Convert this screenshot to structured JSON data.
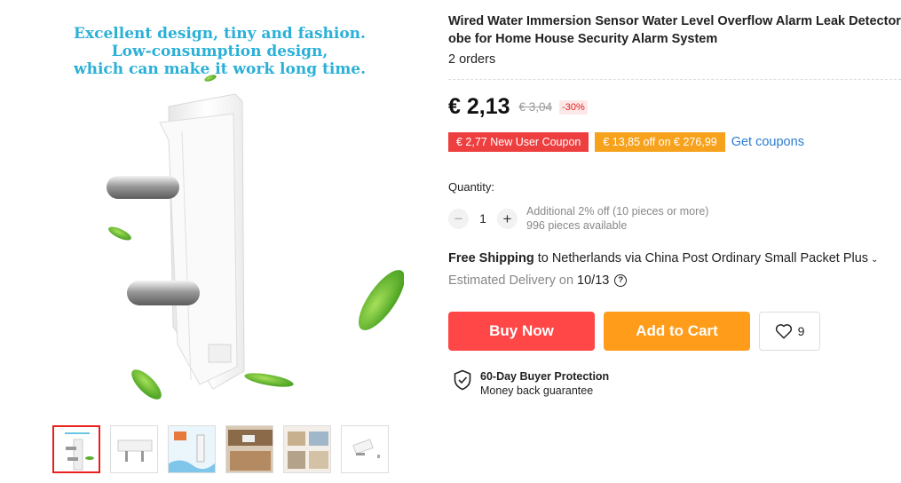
{
  "gallery": {
    "promo_lines": [
      "Excellent design, tiny and fashion.",
      "Low-consumption design,",
      "which can make it work long time."
    ],
    "thumbnail_count": 6,
    "active_thumbnail": 1
  },
  "product": {
    "title_line1": "Wired Water Immersion Sensor Water Level Overflow Alarm Leak Detector Swi",
    "title_line2": "obe for Home House Security Alarm System",
    "orders": "2 orders"
  },
  "pricing": {
    "price": "€ 2,13",
    "original_price": "€ 3,04",
    "discount": "-30%"
  },
  "coupons": {
    "new_user": "€ 2,77 New User Coupon",
    "store": "€ 13,85 off on € 276,99",
    "get_link": "Get coupons"
  },
  "quantity": {
    "label": "Quantity:",
    "value": "1",
    "minus": "−",
    "plus": "+",
    "bulk_note": "Additional 2% off (10 pieces or more)",
    "available": "996 pieces available"
  },
  "shipping": {
    "free_label": "Free Shipping",
    "detail": " to Netherlands via China Post Ordinary Small Packet Plus",
    "delivery_label": "Estimated Delivery on",
    "delivery_date": "10/13",
    "help": "?"
  },
  "actions": {
    "buy_now": "Buy Now",
    "add_to_cart": "Add to Cart",
    "wishlist_count": "9"
  },
  "protection": {
    "title": "60-Day Buyer Protection",
    "subtitle": "Money back guarantee"
  },
  "colors": {
    "buy_now": "#ff4747",
    "add_to_cart": "#ff9c1a",
    "coupon_red": "#ee3f40",
    "coupon_orange": "#f7a21d",
    "link": "#2a7bcf",
    "promo_text": "#2bb0d8"
  }
}
